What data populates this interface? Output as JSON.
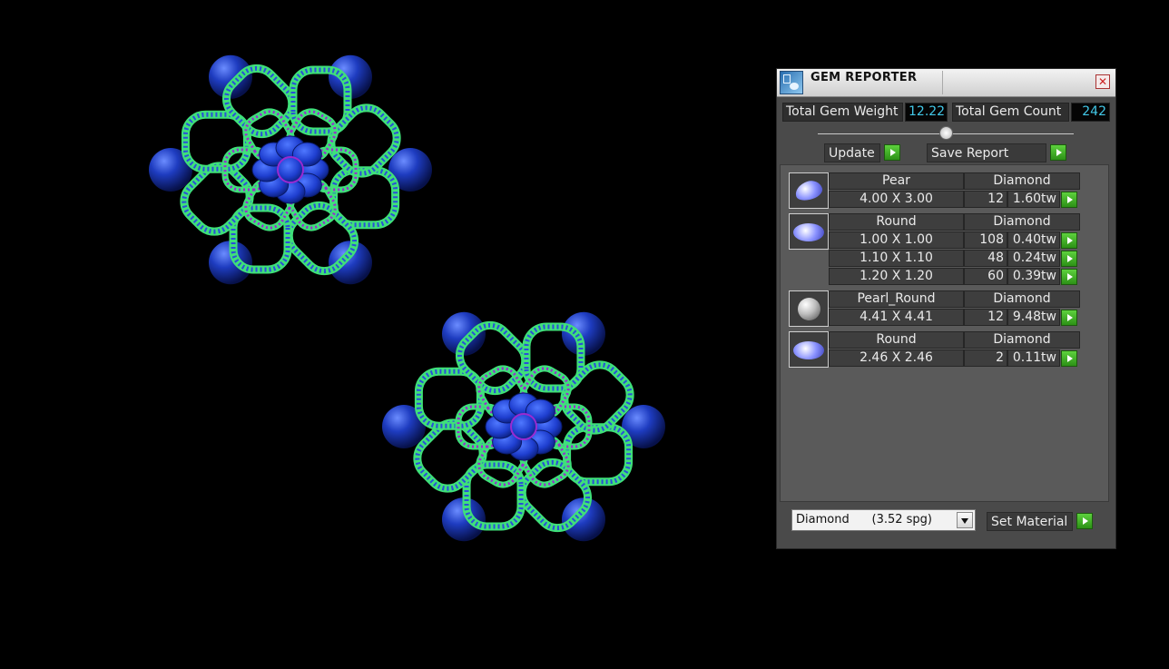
{
  "window": {
    "title": "GEM REPORTER",
    "close_glyph": "✕"
  },
  "summary": {
    "total_weight_label": "Total Gem Weight",
    "total_weight_value": "12.22",
    "total_count_label": "Total Gem Count",
    "total_count_value": "242"
  },
  "actions": {
    "update_label": "Update",
    "save_report_label": "Save Report"
  },
  "gem_groups": [
    {
      "shape": "Pear",
      "material": "Diamond",
      "icon": "pear-gem-icon",
      "rows": [
        {
          "size": "4.00 X 3.00",
          "count": "12",
          "weight": "1.60tw"
        }
      ]
    },
    {
      "shape": "Round",
      "material": "Diamond",
      "icon": "round-gem-icon",
      "rows": [
        {
          "size": "1.00 X 1.00",
          "count": "108",
          "weight": "0.40tw"
        },
        {
          "size": "1.10 X 1.10",
          "count": "48",
          "weight": "0.24tw"
        },
        {
          "size": "1.20 X 1.20",
          "count": "60",
          "weight": "0.39tw"
        }
      ]
    },
    {
      "shape": "Pearl_Round",
      "material": "Diamond",
      "icon": "pearl-icon",
      "rows": [
        {
          "size": "4.41 X 4.41",
          "count": "12",
          "weight": "9.48tw"
        }
      ]
    },
    {
      "shape": "Round",
      "material": "Diamond",
      "icon": "oval-gem-icon",
      "rows": [
        {
          "size": "2.46 X 2.46",
          "count": "2",
          "weight": "0.11tw"
        }
      ]
    }
  ],
  "material": {
    "selected": "Diamond      (3.52 spg)",
    "set_material_label": "Set Material"
  },
  "colors": {
    "metal_green": "#3fe07a",
    "gem_blue": "#2a4fd8",
    "pave_purple": "#9a2ad0",
    "pearl_blue": "#1e3cc0",
    "value_cyan": "#42c8e8",
    "go_green": "#3cb520"
  }
}
